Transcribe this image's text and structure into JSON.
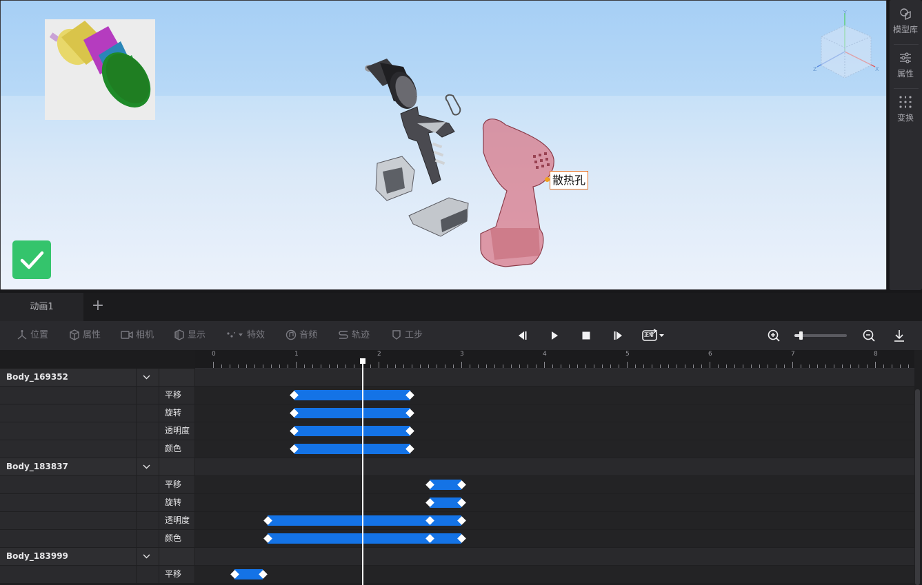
{
  "viewport": {
    "callout_label": "散热孔",
    "gizmo_axes": {
      "x": "X",
      "y": "Y",
      "z": "Z"
    }
  },
  "right_dock": {
    "items": [
      {
        "label": "模型库",
        "icon": "cube-library-icon"
      },
      {
        "label": "属性",
        "icon": "sliders-icon"
      },
      {
        "label": "变换",
        "icon": "transform-grid-icon"
      }
    ]
  },
  "tabs": {
    "items": [
      {
        "label": "动画1"
      }
    ],
    "add_label": "+"
  },
  "toolbar": {
    "tools": [
      {
        "label": "位置",
        "icon": "axis-icon"
      },
      {
        "label": "属性",
        "icon": "cube-icon"
      },
      {
        "label": "相机",
        "icon": "camera-icon"
      },
      {
        "label": "显示",
        "icon": "display-icon"
      },
      {
        "label": "特效",
        "icon": "effects-icon"
      },
      {
        "label": "音频",
        "icon": "audio-icon"
      },
      {
        "label": "轨迹",
        "icon": "track-icon"
      },
      {
        "label": "工步",
        "icon": "step-icon"
      }
    ],
    "playback_mode_label": "正常",
    "zoom_level": 0.12
  },
  "timeline": {
    "ruler_labels": [
      "0",
      "1",
      "2",
      "3",
      "4",
      "5",
      "6",
      "7",
      "8"
    ],
    "playhead_time": 1.81,
    "groups": [
      {
        "name": "Body_169352",
        "tracks": [
          {
            "label": "平移",
            "keys": [
              0.98,
              2.38
            ]
          },
          {
            "label": "旋转",
            "keys": [
              0.98,
              2.38
            ]
          },
          {
            "label": "透明度",
            "keys": [
              0.98,
              2.38
            ]
          },
          {
            "label": "颜色",
            "keys": [
              0.98,
              2.38
            ]
          }
        ]
      },
      {
        "name": "Body_183837",
        "tracks": [
          {
            "label": "平移",
            "keys": [
              2.62,
              3.0
            ]
          },
          {
            "label": "旋转",
            "keys": [
              2.62,
              3.0
            ]
          },
          {
            "label": "透明度",
            "keys": [
              0.66,
              2.62,
              3.0
            ]
          },
          {
            "label": "颜色",
            "keys": [
              0.66,
              2.62,
              3.0
            ]
          }
        ]
      },
      {
        "name": "Body_183999",
        "tracks": [
          {
            "label": "平移",
            "keys": [
              0.26,
              0.6
            ]
          }
        ]
      }
    ]
  }
}
